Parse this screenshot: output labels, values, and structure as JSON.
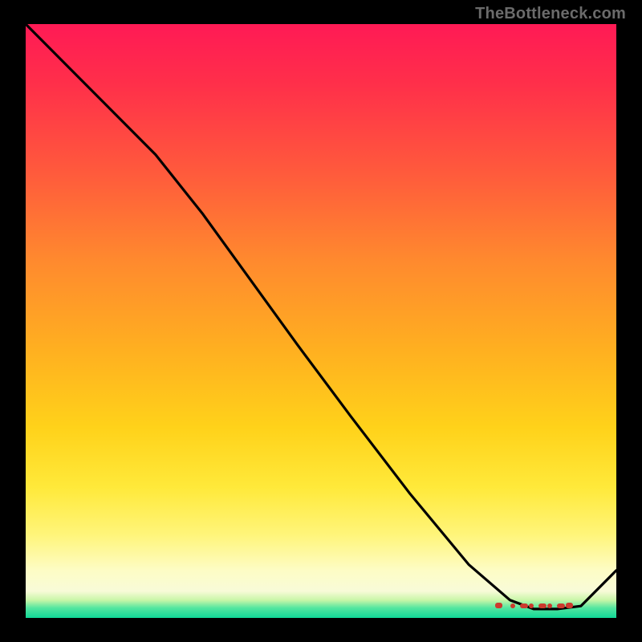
{
  "watermark": "TheBottleneck.com",
  "chart_data": {
    "type": "line",
    "x": [
      0.0,
      0.08,
      0.15,
      0.22,
      0.3,
      0.38,
      0.46,
      0.55,
      0.65,
      0.75,
      0.82,
      0.86,
      0.9,
      0.94,
      1.0
    ],
    "values": [
      100,
      92,
      85,
      78,
      68,
      57,
      46,
      34,
      21,
      9,
      3,
      1.5,
      1.5,
      2.0,
      8
    ],
    "title": "",
    "xlabel": "",
    "ylabel": "",
    "ylim": [
      0,
      100
    ],
    "annotations": {
      "valley_dash_range_x": [
        0.8,
        0.92
      ]
    }
  },
  "gradient_stops": [
    {
      "pos": 0.0,
      "color": "#ff1a55"
    },
    {
      "pos": 0.55,
      "color": "#ffd21a"
    },
    {
      "pos": 0.93,
      "color": "#fdfcc5"
    },
    {
      "pos": 1.0,
      "color": "#10d897"
    }
  ]
}
